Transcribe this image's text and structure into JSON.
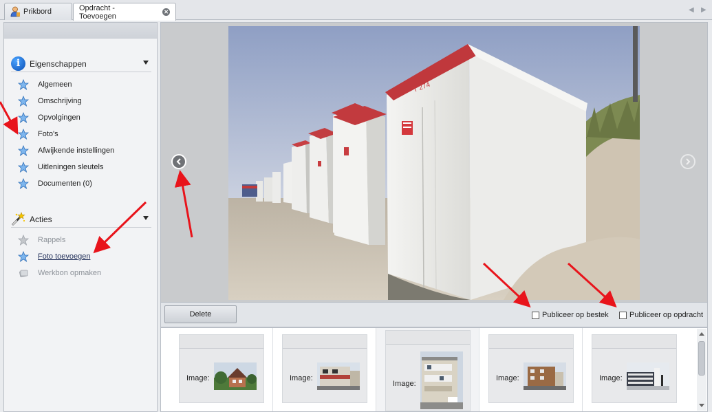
{
  "tabs": [
    {
      "label": "Prikbord",
      "icon": "person-icon"
    },
    {
      "label": "Opdracht - Toevoegen",
      "icon": "close-icon"
    }
  ],
  "sidebar": {
    "properties": {
      "title": "Eigenschappen",
      "icon": "info-icon",
      "items": [
        {
          "label": "Algemeen"
        },
        {
          "label": "Omschrijving"
        },
        {
          "label": "Opvolgingen"
        },
        {
          "label": "Foto's"
        },
        {
          "label": "Afwijkende instellingen"
        },
        {
          "label": "Uitleningen sleutels"
        },
        {
          "label": "Documenten (0)"
        }
      ]
    },
    "actions": {
      "title": "Acties",
      "icon": "magic-wand-icon",
      "items": [
        {
          "label": "Rappels",
          "state": "disabled"
        },
        {
          "label": "Foto toevoegen",
          "state": "link"
        },
        {
          "label": "Werkbon opmaken",
          "state": "disabled"
        }
      ]
    }
  },
  "viewer": {
    "photo_label": "T 274",
    "prev_icon": "chevron-left-icon",
    "next_icon": "chevron-right-icon"
  },
  "actionbar": {
    "delete_label": "Delete",
    "publish_bestek_label": "Publiceer op bestek",
    "publish_opdracht_label": "Publiceer op opdracht",
    "publish_bestek_checked": false,
    "publish_opdracht_checked": false
  },
  "thumbnails": [
    {
      "label": "Image:",
      "selected": false
    },
    {
      "label": "Image:",
      "selected": false
    },
    {
      "label": "Image:",
      "selected": true
    },
    {
      "label": "Image:",
      "selected": false
    },
    {
      "label": "Image:",
      "selected": false
    }
  ],
  "colors": {
    "annotation_arrow": "#e8141b",
    "star_active": "#3f8de0",
    "star_disabled": "#9ea3aa"
  }
}
